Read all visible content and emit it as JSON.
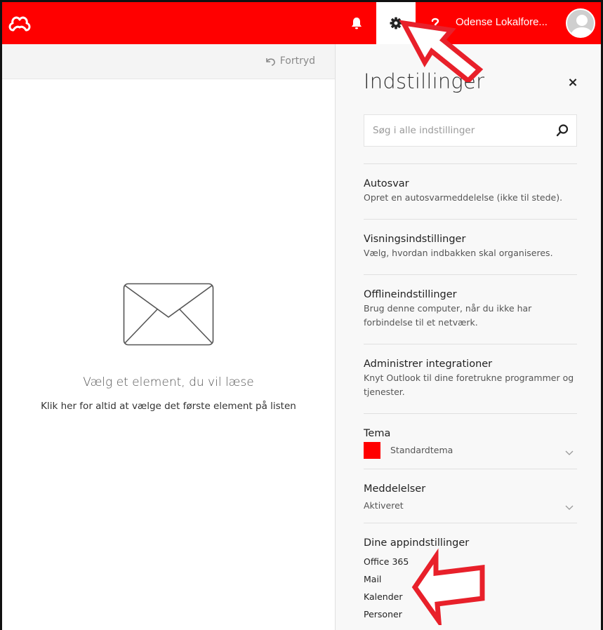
{
  "colors": {
    "brand": "#ff0000",
    "arrow": "#e8202a"
  },
  "topbar": {
    "icons": [
      "logo-icon",
      "bell-icon",
      "gear-icon",
      "help-icon"
    ],
    "user_name": "Odense Lokalfore..."
  },
  "reading": {
    "undo_label": "Fortryd",
    "empty_title": "Vælg et element, du vil læse",
    "empty_sub": "Klik her for altid at vælge det første element på listen"
  },
  "settings": {
    "title": "Indstillinger",
    "close": "×",
    "search_placeholder": "Søg i alle indstillinger",
    "items": [
      {
        "title": "Autosvar",
        "desc": "Opret en autosvarmeddelelse (ikke til stede)."
      },
      {
        "title": "Visningsindstillinger",
        "desc": "Vælg, hvordan indbakken skal organiseres."
      },
      {
        "title": "Offlineindstillinger",
        "desc": "Brug denne computer, når du ikke har forbindelse til et netværk."
      },
      {
        "title": "Administrer integrationer",
        "desc": "Knyt Outlook til dine foretrukne programmer og tjenester."
      }
    ],
    "theme": {
      "title": "Tema",
      "value": "Standardtema",
      "color": "#ff0000"
    },
    "notifications": {
      "title": "Meddelelser",
      "value": "Aktiveret"
    },
    "apps": {
      "title": "Dine appindstillinger",
      "links": [
        "Office 365",
        "Mail",
        "Kalender",
        "Personer"
      ]
    }
  }
}
